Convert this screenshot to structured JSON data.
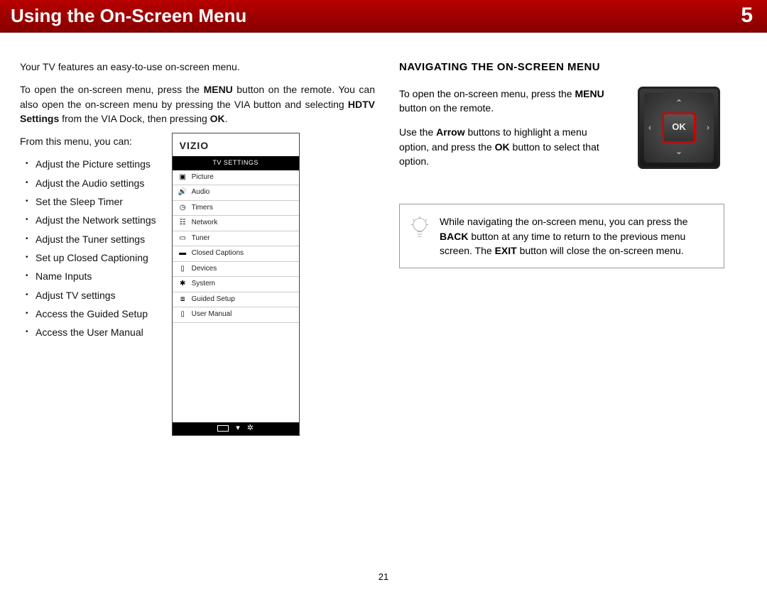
{
  "banner": {
    "title": "Using the On-Screen Menu",
    "chapter": "5"
  },
  "page_number": "21",
  "left": {
    "intro1": "Your TV features an easy-to-use on-screen menu.",
    "intro2_pre": "To open the on-screen menu, press the ",
    "intro2_menu": "MENU",
    "intro2_mid": " button on the remote. You can also open the on-screen menu by pressing the VIA button and selecting ",
    "intro2_hdtv": "HDTV Settings",
    "intro2_mid2": " from the VIA Dock, then pressing ",
    "intro2_ok": "OK",
    "intro2_end": ".",
    "from_this": "From this menu, you can:",
    "bullets": [
      "Adjust the Picture settings",
      "Adjust the Audio settings",
      "Set the Sleep Timer",
      "Adjust the Network settings",
      "Adjust the Tuner settings",
      "Set up Closed Captioning",
      "Name Inputs",
      "Adjust TV settings",
      "Access the Guided Setup",
      "Access the User Manual"
    ],
    "tvmenu": {
      "brand": "VIZIO",
      "heading": "TV SETTINGS",
      "items": [
        {
          "icon": "picture-icon",
          "label": "Picture"
        },
        {
          "icon": "speaker-icon",
          "label": "Audio"
        },
        {
          "icon": "clock-icon",
          "label": "Timers"
        },
        {
          "icon": "network-icon",
          "label": "Network"
        },
        {
          "icon": "tuner-icon",
          "label": "Tuner"
        },
        {
          "icon": "cc-icon",
          "label": "Closed Captions"
        },
        {
          "icon": "devices-icon",
          "label": "Devices"
        },
        {
          "icon": "gear-icon",
          "label": "System"
        },
        {
          "icon": "setup-icon",
          "label": "Guided Setup"
        },
        {
          "icon": "manual-icon",
          "label": "User Manual"
        }
      ]
    }
  },
  "right": {
    "heading": "NAVIGATING THE ON-SCREEN MENU",
    "p1_pre": "To open the on-screen menu, press the ",
    "p1_menu": "MENU",
    "p1_end": " button on the remote.",
    "p2_pre": "Use the ",
    "p2_arrow": "Arrow",
    "p2_mid": " buttons to highlight a menu option, and press the ",
    "p2_ok": "OK",
    "p2_end": " button to select that option.",
    "ok_label": "OK",
    "tip_pre": "While navigating the on-screen menu, you can press the ",
    "tip_back": "BACK",
    "tip_mid": " button at any time to return to the previous menu screen. The ",
    "tip_exit": "EXIT",
    "tip_end": " button will close the on-screen menu."
  }
}
